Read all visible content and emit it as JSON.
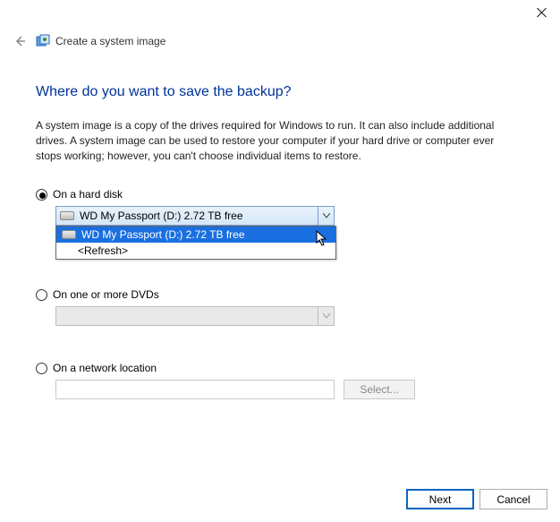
{
  "window": {
    "title": "Create a system image"
  },
  "heading": "Where do you want to save the backup?",
  "description": "A system image is a copy of the drives required for Windows to run. It can also include additional drives. A system image can be used to restore your computer if your hard drive or computer ever stops working; however, you can't choose individual items to restore.",
  "options": {
    "hard_disk": {
      "label": "On a hard disk",
      "selected_text": "WD My Passport (D:)  2.72 TB free",
      "dropdown": {
        "item_selected": "WD My Passport (D:)  2.72 TB free",
        "item_refresh": "<Refresh>"
      }
    },
    "dvd": {
      "label": "On one or more DVDs",
      "selected_text": ""
    },
    "network": {
      "label": "On a network location",
      "value": "",
      "select_button": "Select..."
    }
  },
  "footer": {
    "next": "Next",
    "cancel": "Cancel"
  }
}
